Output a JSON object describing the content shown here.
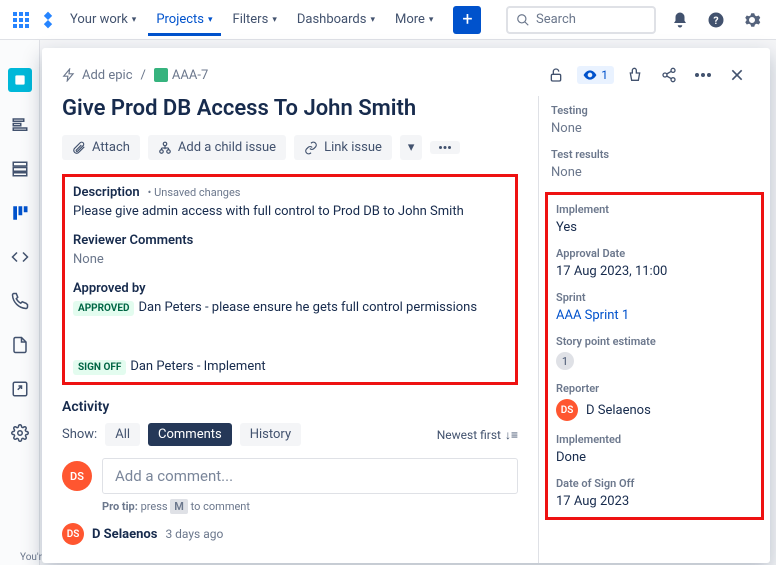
{
  "topnav": {
    "your_work": "Your work",
    "projects": "Projects",
    "filters": "Filters",
    "dashboards": "Dashboards",
    "more": "More",
    "search_placeholder": "Search"
  },
  "modal": {
    "add_epic": "Add epic",
    "issue_key": "AAA-7",
    "watch_count": "1",
    "title": "Give Prod DB Access To John Smith",
    "actions": {
      "attach": "Attach",
      "add_child": "Add a child issue",
      "link": "Link issue"
    },
    "desc": {
      "label": "Description",
      "unsaved": "• Unsaved changes",
      "text": "Please give admin access with full control to Prod DB to John Smith"
    },
    "reviewer": {
      "label": "Reviewer Comments",
      "text": "None"
    },
    "approved": {
      "label": "Approved by",
      "badge": "APPROVED",
      "text": "Dan Peters - please ensure he gets full control permissions"
    },
    "signoff": {
      "badge": "SIGN OFF",
      "text": "Dan Peters  - Implement"
    },
    "activity": {
      "label": "Activity",
      "show": "Show:",
      "tab_all": "All",
      "tab_comments": "Comments",
      "tab_history": "History",
      "sort": "Newest first",
      "placeholder": "Add a comment...",
      "protip_a": "Pro tip:",
      "protip_b": "press",
      "protip_key": "M",
      "protip_c": "to comment",
      "avatar": "DS",
      "past_name": "D Selaenos",
      "past_time": "3 days ago"
    }
  },
  "side": {
    "testing": {
      "label": "Testing",
      "val": "None"
    },
    "test_results": {
      "label": "Test results",
      "val": "None"
    },
    "implement": {
      "label": "Implement",
      "val": "Yes"
    },
    "approval_date": {
      "label": "Approval Date",
      "val": "17 Aug 2023, 11:00"
    },
    "sprint": {
      "label": "Sprint",
      "val": "AAA Sprint 1"
    },
    "story_pts": {
      "label": "Story point estimate",
      "val": "1"
    },
    "reporter": {
      "label": "Reporter",
      "val": "D Selaenos",
      "avatar": "DS"
    },
    "implemented": {
      "label": "Implemented",
      "val": "Done"
    },
    "date_signoff": {
      "label": "Date of Sign Off",
      "val": "17 Aug 2023"
    }
  },
  "footer": "You're in a team-managed project"
}
